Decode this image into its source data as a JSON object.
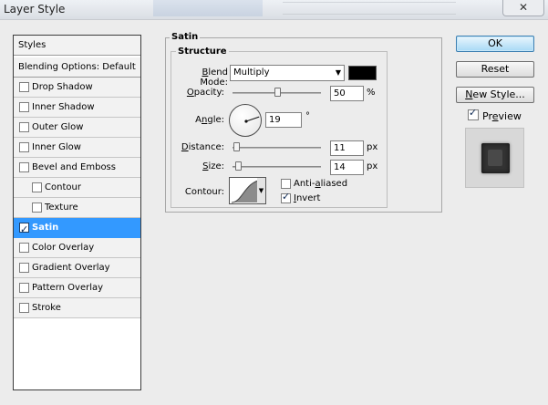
{
  "window": {
    "title": "Layer Style",
    "close_glyph": "✕"
  },
  "styles_panel": {
    "header": "Styles",
    "blending_options": "Blending Options: Default",
    "items": [
      {
        "label": "Drop Shadow",
        "checked": false,
        "indent": false,
        "selected": false
      },
      {
        "label": "Inner Shadow",
        "checked": false,
        "indent": false,
        "selected": false
      },
      {
        "label": "Outer Glow",
        "checked": false,
        "indent": false,
        "selected": false
      },
      {
        "label": "Inner Glow",
        "checked": false,
        "indent": false,
        "selected": false
      },
      {
        "label": "Bevel and Emboss",
        "checked": false,
        "indent": false,
        "selected": false
      },
      {
        "label": "Contour",
        "checked": false,
        "indent": true,
        "selected": false
      },
      {
        "label": "Texture",
        "checked": false,
        "indent": true,
        "selected": false
      },
      {
        "label": "Satin",
        "checked": true,
        "indent": false,
        "selected": true
      },
      {
        "label": "Color Overlay",
        "checked": false,
        "indent": false,
        "selected": false
      },
      {
        "label": "Gradient Overlay",
        "checked": false,
        "indent": false,
        "selected": false
      },
      {
        "label": "Pattern Overlay",
        "checked": false,
        "indent": false,
        "selected": false
      },
      {
        "label": "Stroke",
        "checked": false,
        "indent": false,
        "selected": false
      }
    ]
  },
  "satin": {
    "group_title": "Satin",
    "structure_title": "Structure",
    "blend_mode": {
      "label": "Blend Mode:",
      "value": "Multiply",
      "color": "#000000"
    },
    "opacity": {
      "label": "Opacity:",
      "value": "50",
      "unit": "%",
      "level": 0.5
    },
    "angle": {
      "label": "Angle:",
      "value": "19",
      "unit": "°",
      "degrees": 19
    },
    "distance": {
      "label": "Distance:",
      "value": "11",
      "unit": "px",
      "level": 0.04
    },
    "size": {
      "label": "Size:",
      "value": "14",
      "unit": "px",
      "level": 0.06
    },
    "contour": {
      "label": "Contour:"
    },
    "anti_aliased": {
      "label": "Anti-aliased",
      "checked": false
    },
    "invert": {
      "label": "Invert",
      "checked": true
    }
  },
  "buttons": {
    "ok": "OK",
    "reset": "Reset",
    "new_style": "New Style..."
  },
  "preview": {
    "label": "Preview",
    "checked": true
  },
  "colors": {
    "selection": "#3399ff",
    "ok_button": "#a7d9f5"
  }
}
